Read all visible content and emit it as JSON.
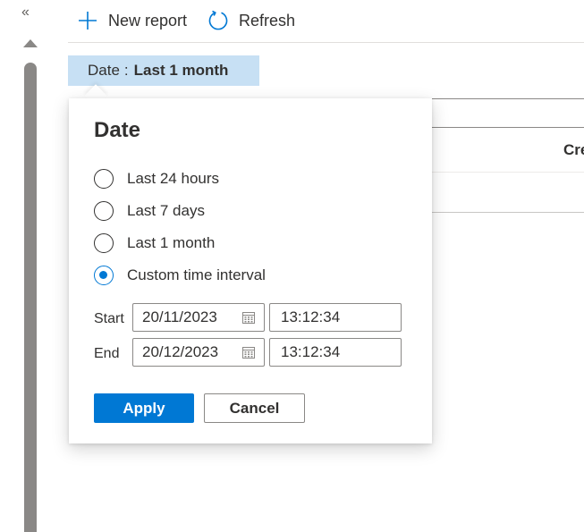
{
  "rail": {
    "collapse_glyph": "«",
    "collapse_icon": "double-chevron-left-icon"
  },
  "toolbar": {
    "new_report_label": "New report",
    "new_report_icon": "plus-icon",
    "refresh_label": "Refresh",
    "refresh_icon": "refresh-icon"
  },
  "filter_pill": {
    "key": "Date",
    "separator": ":",
    "value": "Last 1 month"
  },
  "background_table": {
    "header_partial": "Cre"
  },
  "date_callout": {
    "title": "Date",
    "options": [
      {
        "label": "Last 24 hours",
        "checked": false
      },
      {
        "label": "Last 7 days",
        "checked": false
      },
      {
        "label": "Last 1 month",
        "checked": false
      },
      {
        "label": "Custom time interval",
        "checked": true
      }
    ],
    "start": {
      "label": "Start",
      "date": "20/11/2023",
      "time": "13:12:34"
    },
    "end": {
      "label": "End",
      "date": "20/12/2023",
      "time": "13:12:34"
    },
    "apply_label": "Apply",
    "cancel_label": "Cancel"
  },
  "colors": {
    "accent": "#0078d4",
    "pill_background": "#c7e0f4",
    "text": "#323130",
    "border": "#8a8886"
  }
}
